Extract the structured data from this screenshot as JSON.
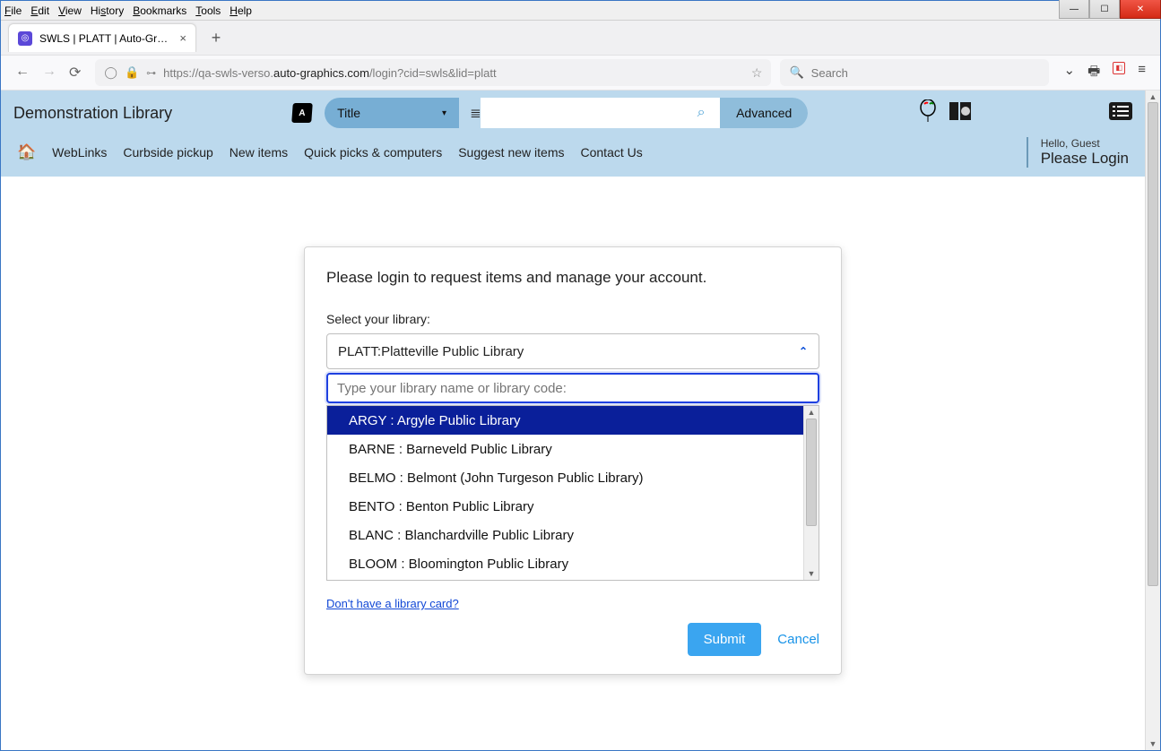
{
  "os_menu": [
    "File",
    "Edit",
    "View",
    "History",
    "Bookmarks",
    "Tools",
    "Help"
  ],
  "tab": {
    "title": "SWLS | PLATT | Auto-Graphics In"
  },
  "url": {
    "prefix": "https://qa-swls-verso.",
    "domain": "auto-graphics.com",
    "suffix": "/login?cid=swls&lid=platt"
  },
  "browser_search": {
    "placeholder": "Search"
  },
  "library": {
    "name": "Demonstration Library",
    "search_type": "Title",
    "advanced": "Advanced",
    "nav": [
      "WebLinks",
      "Curbside pickup",
      "New items",
      "Quick picks & computers",
      "Suggest new items",
      "Contact Us"
    ],
    "greeting": "Hello, Guest",
    "login_prompt": "Please Login"
  },
  "modal": {
    "heading": "Please login to request items and manage your account.",
    "select_label": "Select your library:",
    "selected": "PLATT:Platteville Public Library",
    "filter_placeholder": "Type your library name or library code:",
    "options": [
      "ARGY : Argyle Public Library",
      "BARNE : Barneveld Public Library",
      "BELMO : Belmont (John Turgeson Public Library)",
      "BENTO : Benton Public Library",
      "BLANC : Blanchardville Public Library",
      "BLOOM : Bloomington Public Library"
    ],
    "no_card": "Don't have a library card?",
    "submit": "Submit",
    "cancel": "Cancel"
  }
}
